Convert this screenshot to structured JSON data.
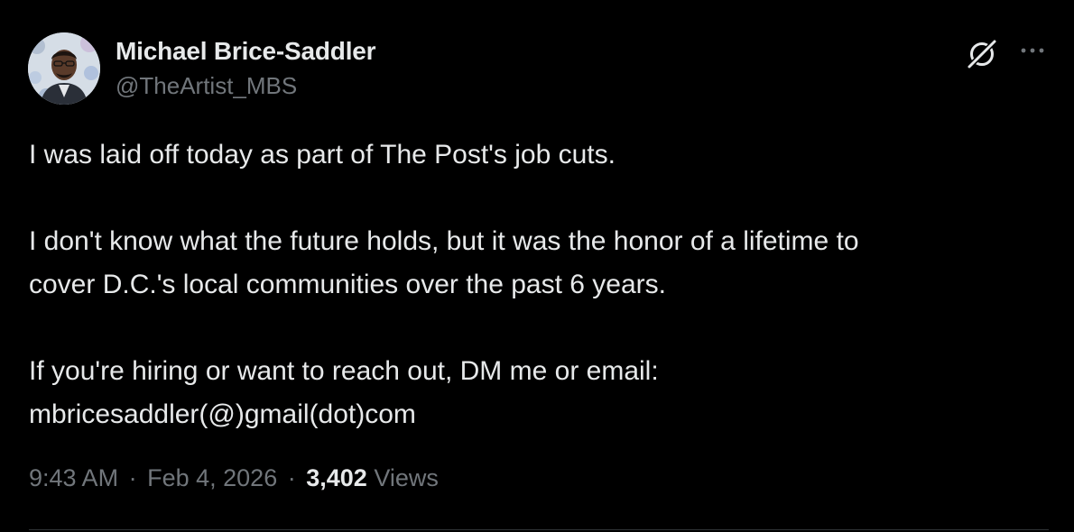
{
  "author": {
    "display_name": "Michael Brice-Saddler",
    "handle": "@TheArtist_MBS",
    "avatar_icon": "profile-photo"
  },
  "actions": {
    "grok_icon": "grok-icon",
    "more_icon": "more-options-icon"
  },
  "tweet": {
    "paragraphs": [
      "I was laid off today as part of The Post's job cuts.",
      "I don't know what the future holds, but it was the honor of a lifetime to\ncover D.C.'s local communities over the past 6 years.",
      "If you're hiring or want to reach out, DM me or email:\nmbricesaddler(@)gmail(dot)com"
    ]
  },
  "meta": {
    "time": "9:43 AM",
    "separator": "·",
    "date": "Feb 4, 2026",
    "views_count": "3,402",
    "views_label": "Views"
  },
  "colors": {
    "background": "#000000",
    "primary_text": "#e7e9ea",
    "secondary_text": "#71767b",
    "divider": "#2f3336"
  }
}
